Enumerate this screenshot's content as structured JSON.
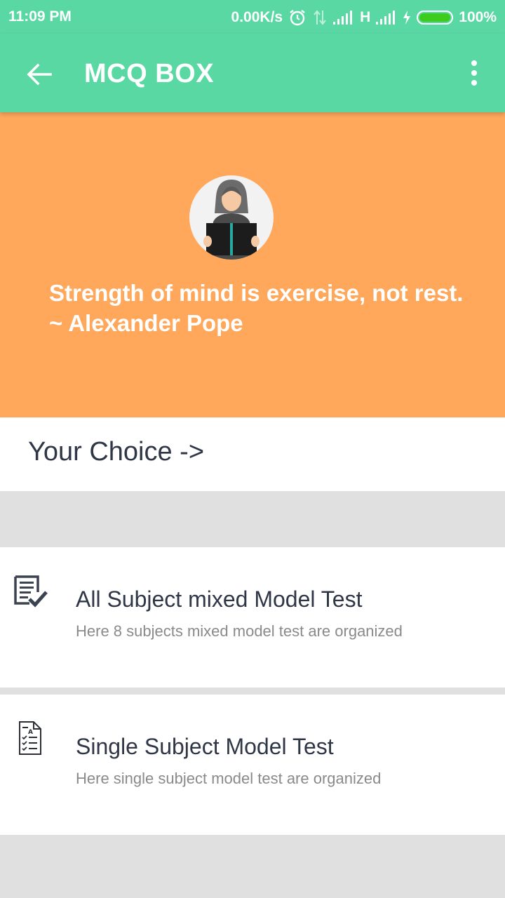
{
  "status_bar": {
    "time": "11:09 PM",
    "net_speed": "0.00K/s",
    "network_type": "H",
    "battery": "100%",
    "icons": [
      "alarm-icon",
      "data-arrows-icon",
      "signal-icon",
      "signal-icon",
      "charging-icon",
      "battery-icon"
    ]
  },
  "app_bar": {
    "title": "MCQ BOX",
    "back_icon": "arrow-back-icon",
    "menu_icon": "more-vert-icon"
  },
  "hero": {
    "quote_line1": "Strength of mind is exercise, not rest.",
    "quote_line2": "~ Alexander Pope",
    "avatar_icon": "reading-woman-avatar"
  },
  "choice": {
    "label": "Your Choice ->"
  },
  "options": [
    {
      "icon": "checklist-doc-icon",
      "title": "All Subject mixed Model Test",
      "subtitle": "Here 8 subjects mixed model test are organized"
    },
    {
      "icon": "quiz-sheet-icon",
      "title": "Single Subject Model Test",
      "subtitle": "Here single subject model test are organized"
    }
  ],
  "colors": {
    "primary": "#5ad8a4",
    "hero_bg": "#ffa85c",
    "text_dark": "#2f3645",
    "text_muted": "#8a8a8a",
    "divider_bg": "#e0e0e0"
  }
}
